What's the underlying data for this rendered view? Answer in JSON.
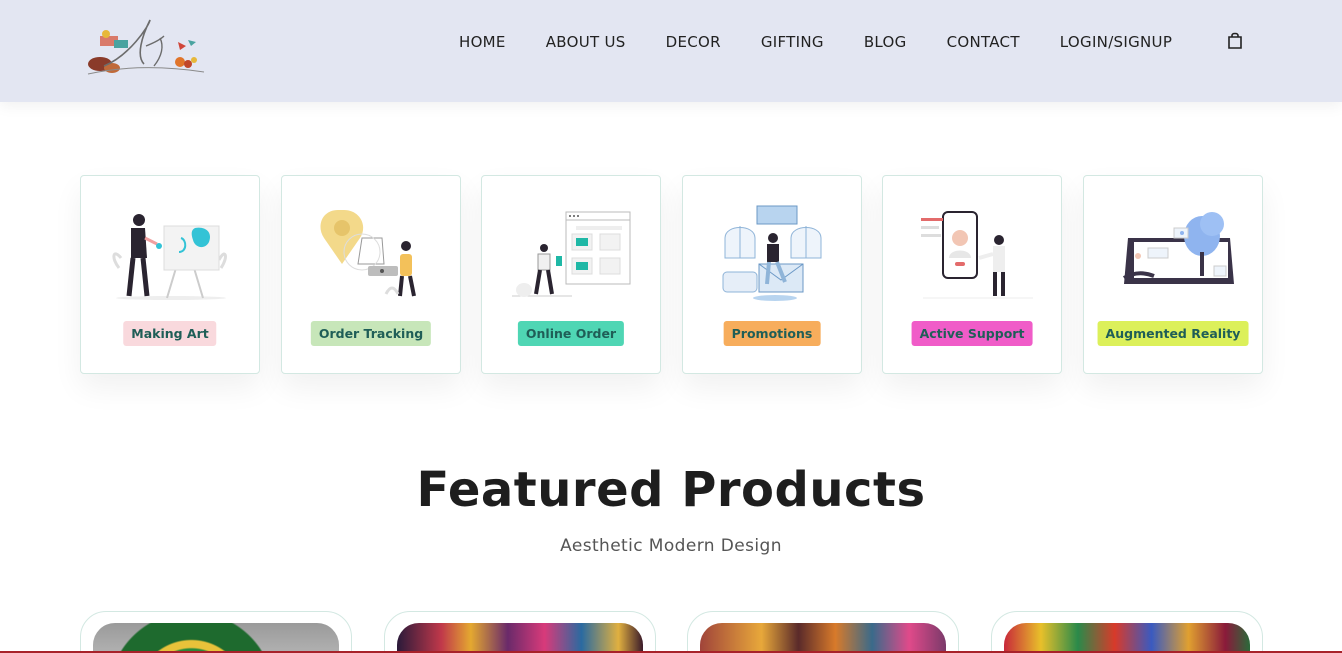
{
  "header": {
    "logo_icon": "brand-logo",
    "nav": [
      "HOME",
      "ABOUT US",
      "DECOR",
      "GIFTING",
      "BLOG",
      "CONTACT",
      "LOGIN/SIGNUP"
    ],
    "cart_icon": "shopping-bag-icon"
  },
  "features": [
    {
      "label": "Making Art",
      "icon": "artist-illustration",
      "badge_bg": "#f9d9dd",
      "badge_fg": "#1f5e57"
    },
    {
      "label": "Order Tracking",
      "icon": "location-tracking-illustration",
      "badge_bg": "#c7e6b9",
      "badge_fg": "#1f5e57"
    },
    {
      "label": "Online Order",
      "icon": "online-shopping-illustration",
      "badge_bg": "#4fd6b4",
      "badge_fg": "#1f5e57"
    },
    {
      "label": "Promotions",
      "icon": "promotion-illustration",
      "badge_bg": "#f7ad5c",
      "badge_fg": "#1f5e57"
    },
    {
      "label": "Active Support",
      "icon": "support-call-illustration",
      "badge_bg": "#f05cc8",
      "badge_fg": "#1f5e57"
    },
    {
      "label": "Augmented Reality",
      "icon": "ar-illustration",
      "badge_bg": "#dcf05a",
      "badge_fg": "#1f5e57"
    }
  ],
  "featured": {
    "title": "Featured Products",
    "subtitle": "Aesthetic Modern Design"
  },
  "products": [
    {
      "icon": "product-image"
    },
    {
      "icon": "product-image"
    },
    {
      "icon": "product-image"
    },
    {
      "icon": "product-image"
    }
  ]
}
